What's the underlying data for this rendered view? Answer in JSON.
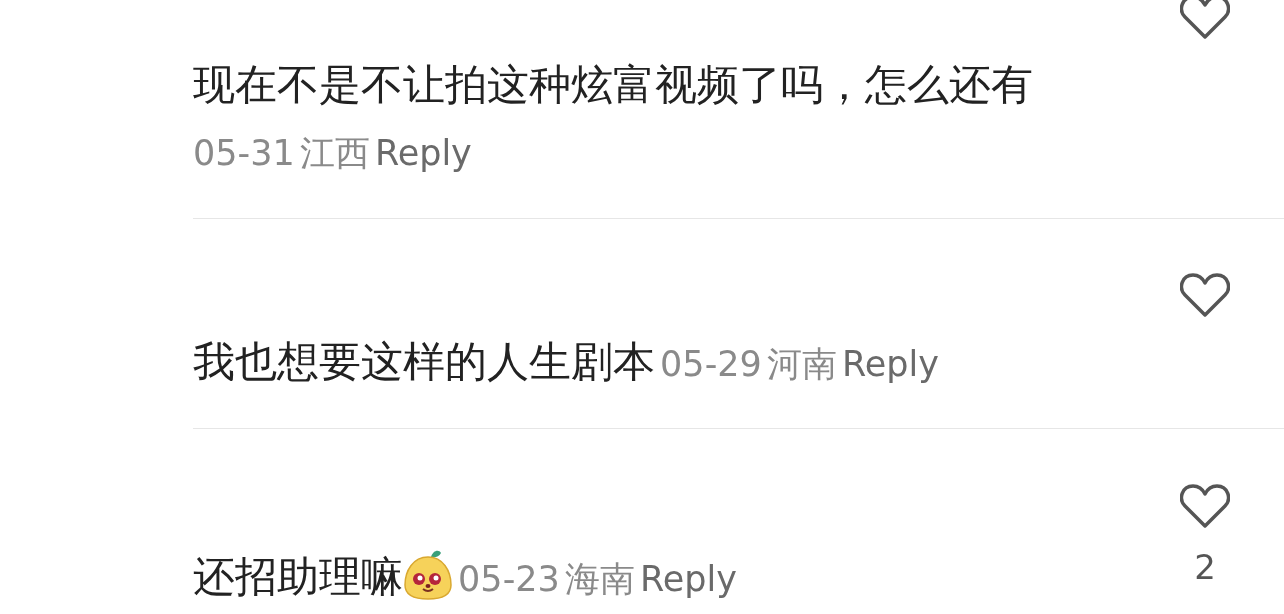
{
  "comments": [
    {
      "kind": "two-line",
      "text": "现在不是不让拍这种炫富视频了吗，怎么还有",
      "date": "05-31",
      "location": "江西",
      "reply": "Reply",
      "sticker": false
    },
    {
      "kind": "inline",
      "text": "我也想要这样的人生剧本",
      "date": "05-29",
      "location": "河南",
      "reply": "Reply",
      "sticker": false
    },
    {
      "kind": "inline",
      "text": "还招助理嘛",
      "date": "05-23",
      "location": "海南",
      "reply": "Reply",
      "sticker": true,
      "likes": "2"
    }
  ]
}
